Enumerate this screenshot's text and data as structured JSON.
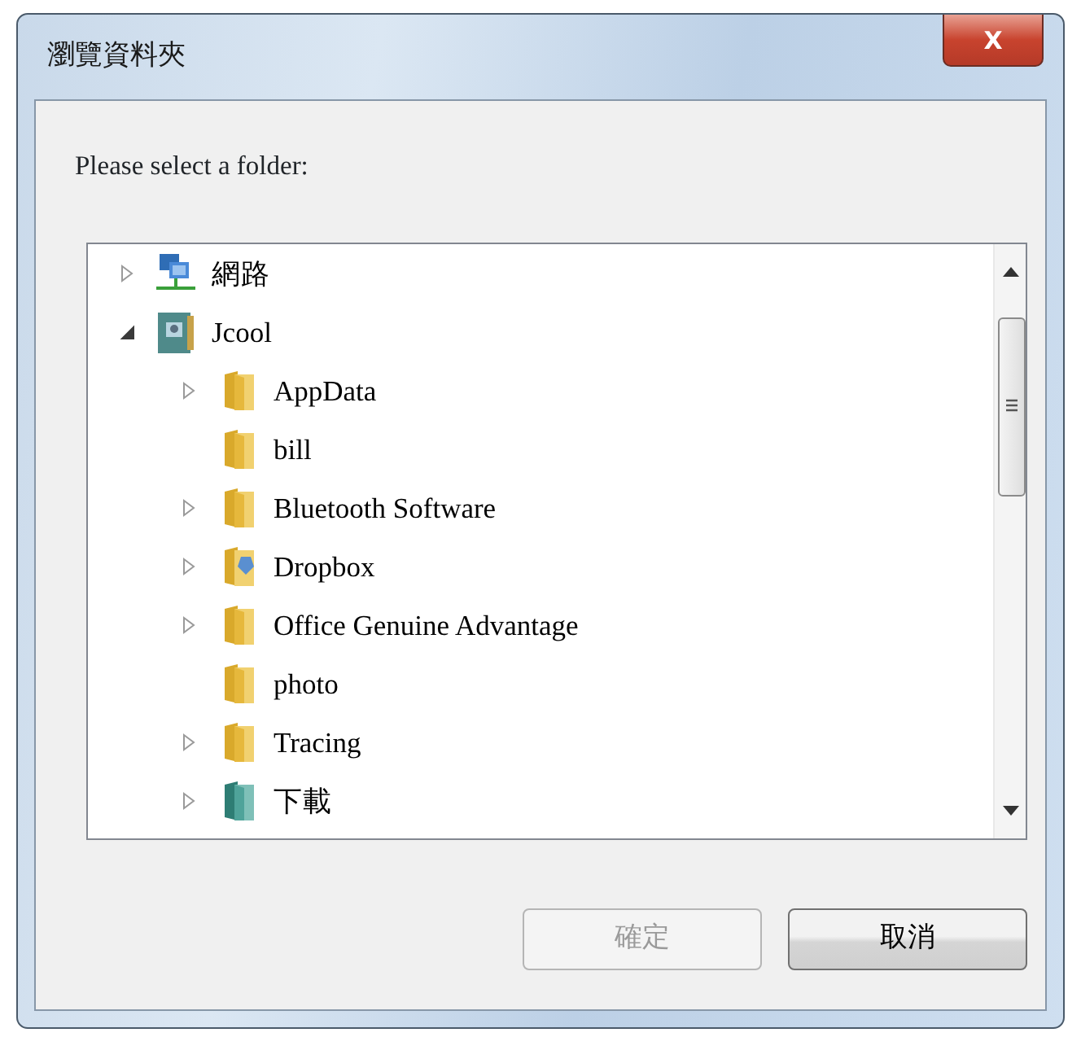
{
  "window": {
    "title": "瀏覽資料夾",
    "close_label": "X"
  },
  "prompt": "Please select a folder:",
  "tree": [
    {
      "label": "網路",
      "kind": "network",
      "has_children": true,
      "expanded": false
    },
    {
      "label": "Jcool",
      "kind": "user",
      "has_children": true,
      "expanded": true,
      "children": [
        {
          "label": "AppData",
          "kind": "folder",
          "has_children": true,
          "expanded": false
        },
        {
          "label": "bill",
          "kind": "folder",
          "has_children": false,
          "expanded": false
        },
        {
          "label": "Bluetooth Software",
          "kind": "folder",
          "has_children": true,
          "expanded": false
        },
        {
          "label": "Dropbox",
          "kind": "dropbox",
          "has_children": true,
          "expanded": false
        },
        {
          "label": "Office Genuine Advantage",
          "kind": "folder",
          "has_children": true,
          "expanded": false
        },
        {
          "label": "photo",
          "kind": "folder",
          "has_children": false,
          "expanded": false
        },
        {
          "label": "Tracing",
          "kind": "folder",
          "has_children": true,
          "expanded": false
        },
        {
          "label": "下載",
          "kind": "downloads",
          "has_children": true,
          "expanded": false
        }
      ]
    }
  ],
  "buttons": [
    {
      "label": "確定",
      "disabled": true
    },
    {
      "label": "取消",
      "disabled": false
    }
  ]
}
